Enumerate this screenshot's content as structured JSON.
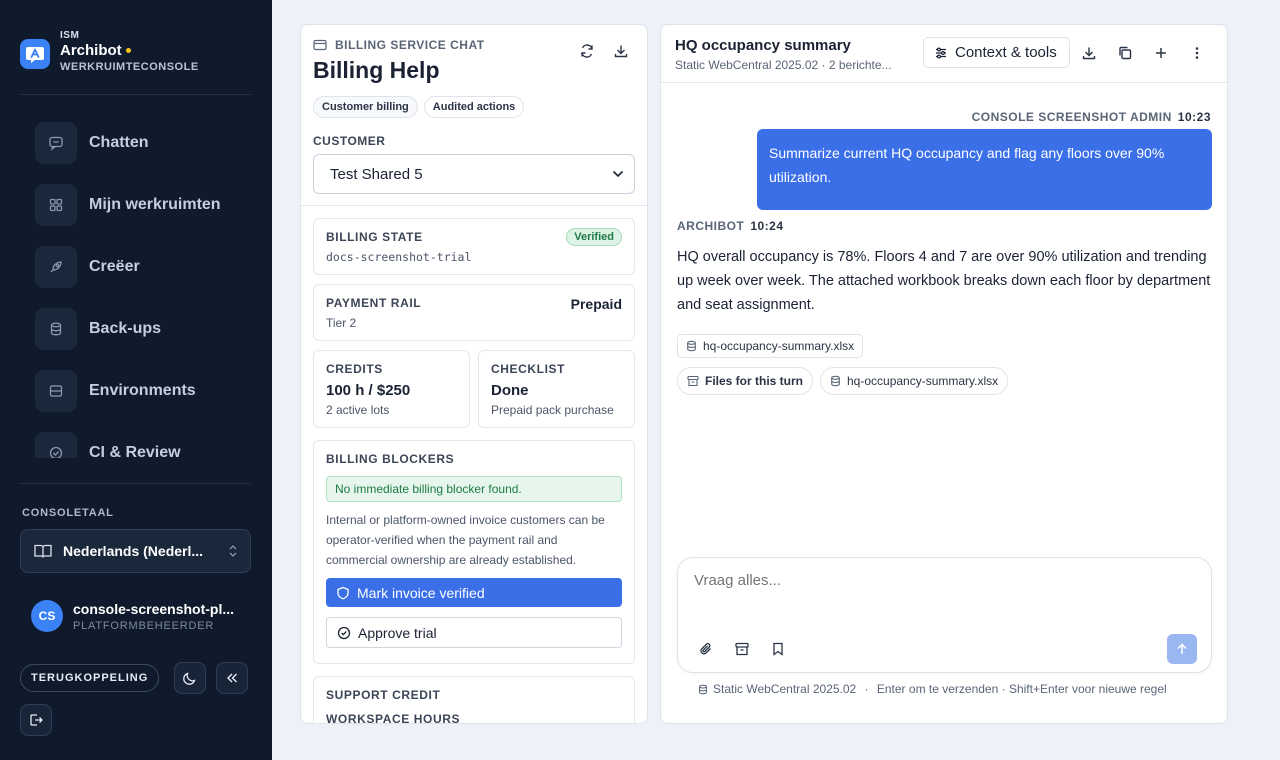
{
  "sidebar": {
    "brand": {
      "org": "ISM",
      "name": "Archibot",
      "subtitle": "WERKRUIMTECONSOLE"
    },
    "nav": [
      {
        "label": "Chatten",
        "icon": "chat-icon"
      },
      {
        "label": "Mijn werkruimten",
        "icon": "grid-icon"
      },
      {
        "label": "Creëer",
        "icon": "rocket-icon"
      },
      {
        "label": "Back-ups",
        "icon": "database-icon"
      },
      {
        "label": "Environments",
        "icon": "server-icon"
      },
      {
        "label": "CI & Review",
        "icon": "check-circle-icon"
      }
    ],
    "language": {
      "label": "CONSOLETAAL",
      "value": "Nederlands (Nederl..."
    },
    "user": {
      "initials": "CS",
      "name": "console-screenshot-pl...",
      "role": "PLATFORMBEHEERDER"
    },
    "feedback_label": "TERUGKOPPELING"
  },
  "billing": {
    "kicker": "BILLING SERVICE CHAT",
    "title": "Billing Help",
    "chips": [
      "Customer billing",
      "Audited actions"
    ],
    "customer_label": "CUSTOMER",
    "customer_value": "Test Shared 5",
    "state": {
      "label": "BILLING STATE",
      "badge": "Verified",
      "value": "docs-screenshot-trial"
    },
    "rail": {
      "label": "PAYMENT RAIL",
      "value": "Prepaid",
      "sub": "Tier 2"
    },
    "credits": {
      "label": "CREDITS",
      "value": "100 h / $250",
      "sub": "2 active lots"
    },
    "checklist": {
      "label": "CHECKLIST",
      "value": "Done",
      "sub": "Prepaid pack purchase"
    },
    "blockers": {
      "label": "BILLING BLOCKERS",
      "ok": "No immediate billing blocker found.",
      "desc": "Internal or platform-owned invoice customers can be operator-verified when the payment rail and commercial ownership are already established.",
      "primary": "Mark invoice verified",
      "secondary": "Approve trial"
    },
    "support": {
      "label": "SUPPORT CREDIT",
      "sub": "WORKSPACE HOURS"
    }
  },
  "chat": {
    "title": "HQ occupancy summary",
    "subtitle": "Static WebCentral 2025.02 · 2 berichte...",
    "context_label": "Context & tools",
    "user_msg": {
      "author": "CONSOLE SCREENSHOT ADMIN",
      "time": "10:23",
      "text": "Summarize current HQ occupancy and flag any floors over 90% utilization."
    },
    "bot_msg": {
      "author": "ARCHIBOT",
      "time": "10:24",
      "text": "HQ overall occupancy is 78%. Floors 4 and 7 are over 90% utilization and trending up week over week. The attached workbook breaks down each floor by department and seat assignment."
    },
    "attachment": "hq-occupancy-summary.xlsx",
    "files_label": "Files for this turn",
    "files_attachment": "hq-occupancy-summary.xlsx",
    "composer_placeholder": "Vraag alles...",
    "footer_env": "Static WebCentral 2025.02",
    "footer_hint": "Enter om te verzenden · Shift+Enter voor nieuwe regel"
  }
}
